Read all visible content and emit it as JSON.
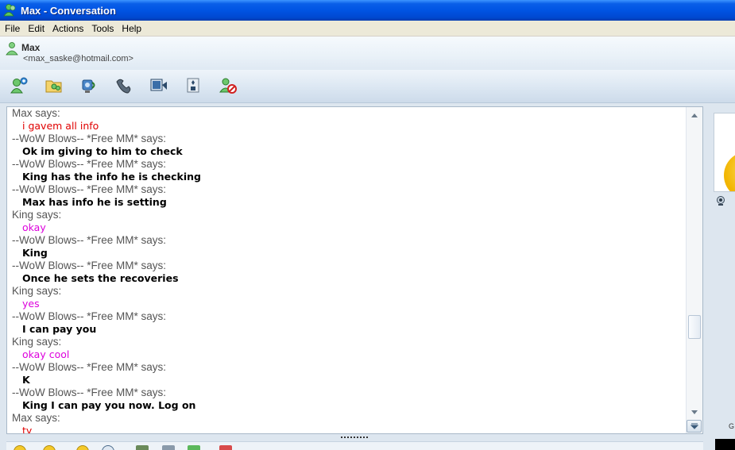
{
  "window": {
    "title": "Max - Conversation"
  },
  "menu": [
    "File",
    "Edit",
    "Actions",
    "Tools",
    "Help"
  ],
  "contact": {
    "name": "Max",
    "email": "<max_saske@hotmail.com>"
  },
  "toolbar_icons": [
    "invite-contact-icon",
    "send-files-icon",
    "webcam-icon",
    "call-icon",
    "video-icon",
    "games-icon",
    "block-icon"
  ],
  "messages": [
    {
      "sender": "Max says:",
      "text": "i gavem all info",
      "style": "red"
    },
    {
      "sender": "--WoW Blows-- *Free MM* says:",
      "text": "Ok im giving to him to check",
      "style": "bold"
    },
    {
      "sender": "--WoW Blows-- *Free MM* says:",
      "text": "King has the info he is checking",
      "style": "bold"
    },
    {
      "sender": "--WoW Blows-- *Free MM* says:",
      "text": "Max has info he is setting",
      "style": "bold"
    },
    {
      "sender": "King says:",
      "text": "okay",
      "style": "magenta"
    },
    {
      "sender": "--WoW Blows-- *Free MM* says:",
      "text": "King",
      "style": "bold"
    },
    {
      "sender": "--WoW Blows-- *Free MM* says:",
      "text": "Once he sets the recoveries",
      "style": "bold"
    },
    {
      "sender": "King says:",
      "text": "yes",
      "style": "magenta"
    },
    {
      "sender": "--WoW Blows-- *Free MM* says:",
      "text": "I can pay you",
      "style": "bold"
    },
    {
      "sender": "King says:",
      "text": "okay cool",
      "style": "magenta"
    },
    {
      "sender": "--WoW Blows-- *Free MM* says:",
      "text": "K",
      "style": "bold"
    },
    {
      "sender": "--WoW Blows-- *Free MM* says:",
      "text": "King I can pay you now. Log on",
      "style": "bold"
    },
    {
      "sender": "Max says:",
      "text": "ty",
      "style": "red"
    }
  ],
  "right_panel": {
    "label": "G"
  },
  "colors": {
    "title_bar": "#0054e3",
    "sender_gray": "#555555",
    "max_red": "#e00000",
    "king_magenta": "#dd00dd"
  }
}
